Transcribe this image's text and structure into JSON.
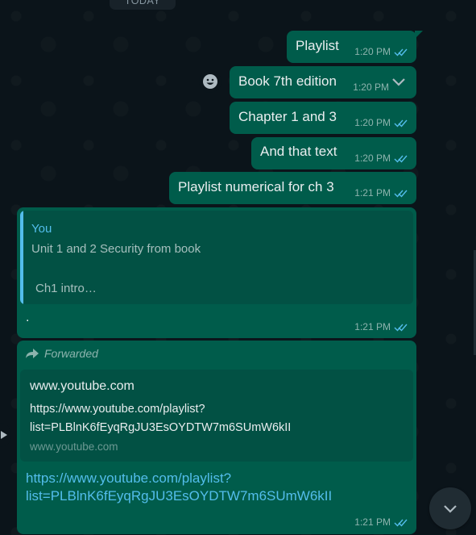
{
  "date_divider": "TODAY",
  "messages": [
    {
      "text": "Playlist",
      "time": "1:20 PM"
    },
    {
      "text": "Book 7th edition",
      "time": "1:20 PM"
    },
    {
      "text": "Chapter 1 and 3",
      "time": "1:20 PM"
    },
    {
      "text": "And that text",
      "time": "1:20 PM"
    },
    {
      "text": "Playlist numerical for ch 3",
      "time": "1:21 PM"
    }
  ],
  "reply_message": {
    "quoted_author": "You",
    "quoted_line1": "Unit 1 and 2 Security from book",
    "quoted_line2": "Ch1 intro…",
    "text": ".",
    "time": "1:21 PM"
  },
  "forwarded_message": {
    "label": "Forwarded",
    "preview_title": "www.youtube.com",
    "preview_desc_line1": "https://www.youtube.com/playlist?",
    "preview_desc_line2": "list=PLBlnK6fEyqRgJU3EsOYDTW7m6SUmW6kII",
    "preview_domain": "www.youtube.com",
    "link_line1": "https://www.youtube.com/playlist?",
    "link_line2": "list=PLBlnK6fEyqRgJU3EsOYDTW7m6SUmW6kII",
    "time": "1:21 PM"
  },
  "icons": {
    "read_receipt": "double-check-icon",
    "emoji": "emoji-icon",
    "menu": "chevron-down-icon",
    "forward": "forward-arrow-icon",
    "scroll": "scroll-down-icon"
  },
  "colors": {
    "background": "#0b141a",
    "outgoing_bubble": "#005c4b",
    "quote_panel": "#025144",
    "accent_blue": "#53bdeb",
    "read_tick": "#53bdeb"
  }
}
